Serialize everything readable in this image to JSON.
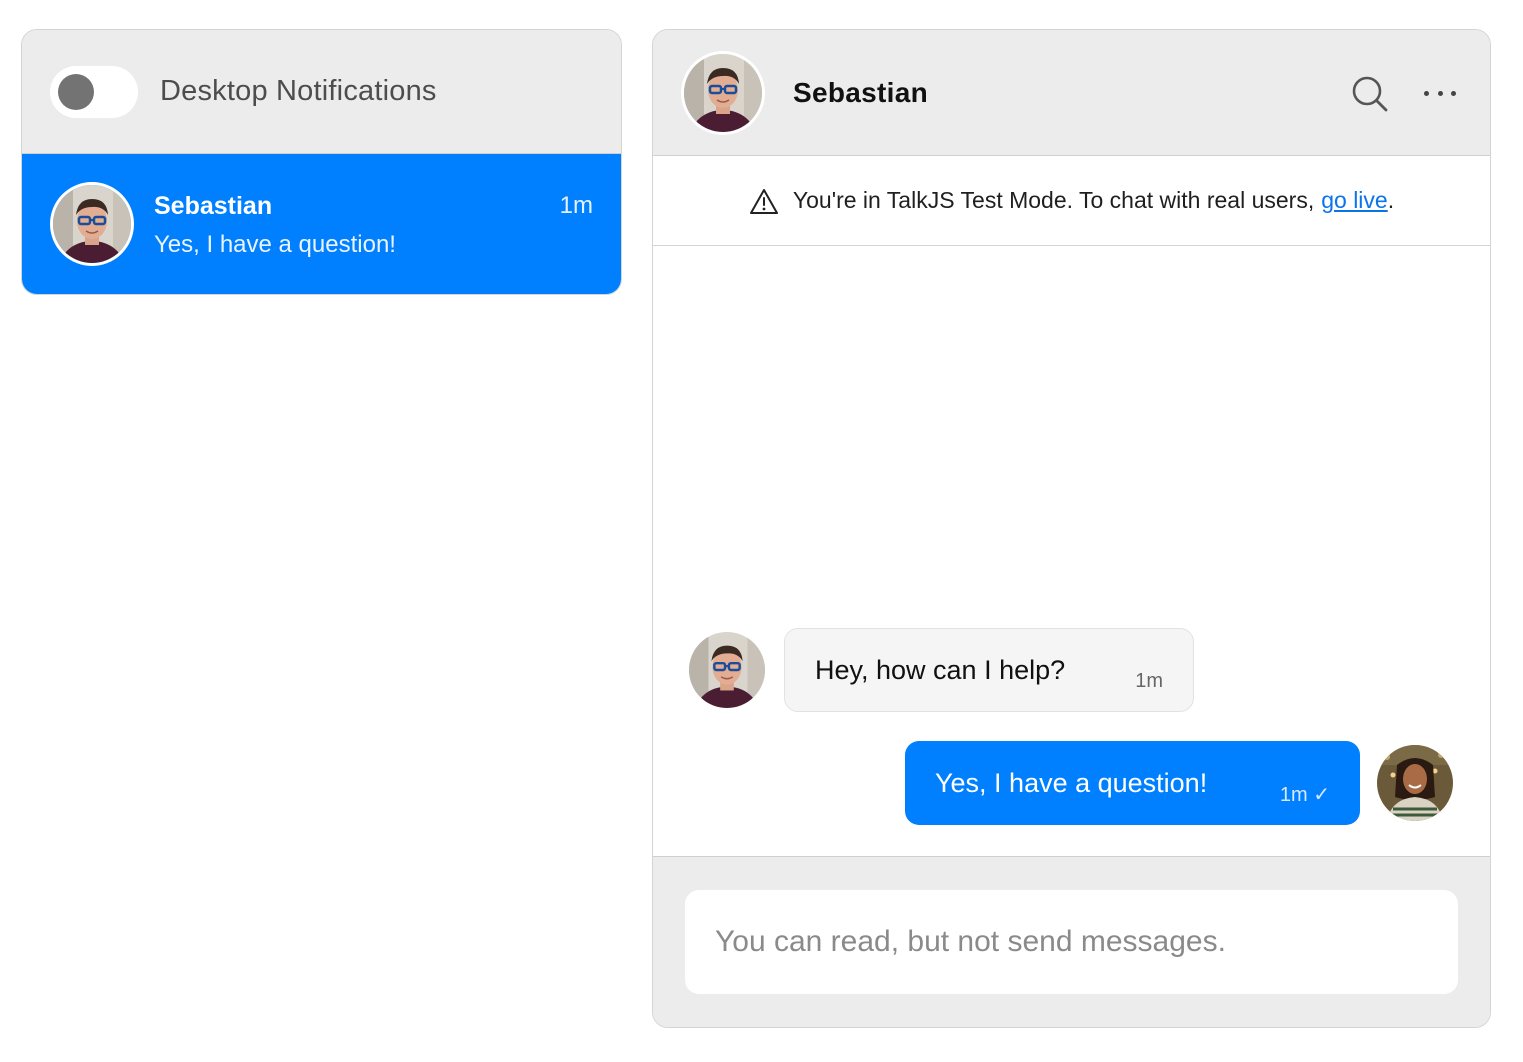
{
  "inbox": {
    "notifications": {
      "label": "Desktop Notifications",
      "enabled": false
    },
    "conversations": [
      {
        "name": "Sebastian",
        "preview": "Yes, I have a question!",
        "time": "1m",
        "selected": true
      }
    ]
  },
  "chat": {
    "header": {
      "name": "Sebastian",
      "icons": [
        "search-icon",
        "more-options-icon"
      ]
    },
    "banner": {
      "text": "You're in TalkJS Test Mode. To chat with real users,",
      "link": "go live",
      "suffix": ".",
      "icon": "warning-icon"
    },
    "messages": [
      {
        "direction": "incoming",
        "text": "Hey, how can I help?",
        "time": "1m"
      },
      {
        "direction": "outgoing",
        "text": "Yes, I have a question!",
        "time": "1m ✓"
      }
    ],
    "compose": {
      "placeholder": "You can read, but not send messages."
    }
  },
  "colors": {
    "accent": "#0080ff",
    "header_bg": "#ececec",
    "incoming_bubble": "#f5f5f5",
    "link": "#0a74ec"
  }
}
